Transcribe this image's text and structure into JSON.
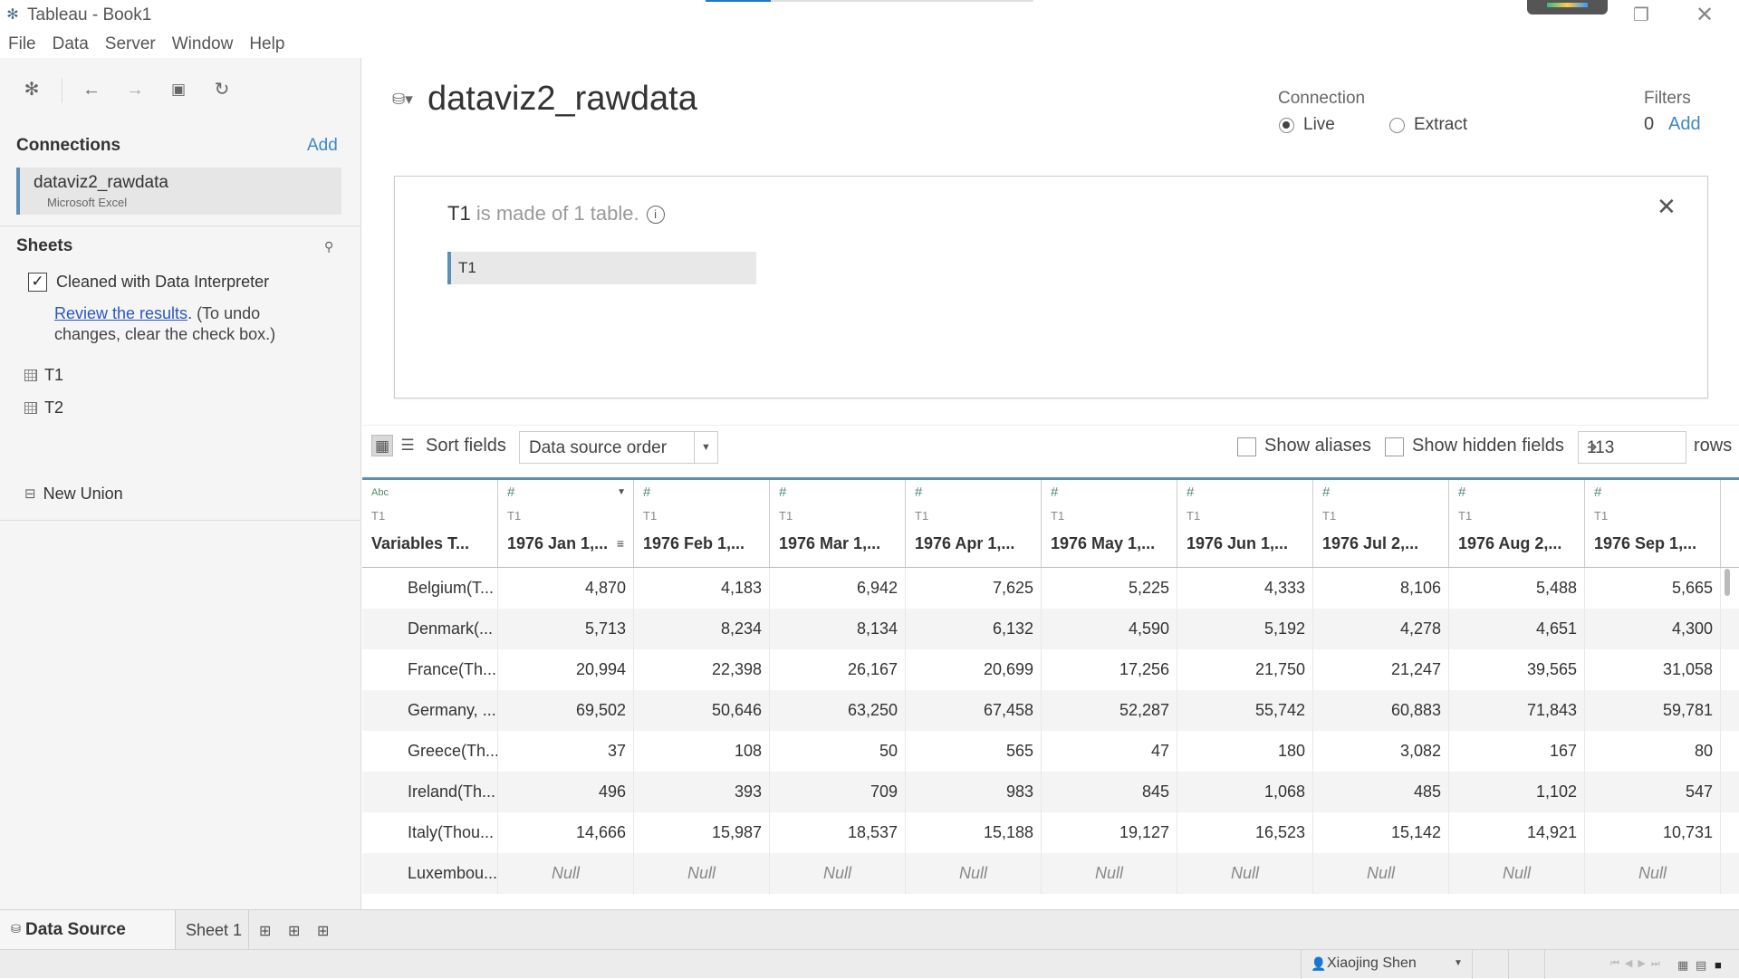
{
  "window": {
    "title": "Tableau - Book1",
    "progress": 0.2
  },
  "menu": [
    "File",
    "Data",
    "Server",
    "Window",
    "Help"
  ],
  "connections": {
    "heading": "Connections",
    "add_label": "Add",
    "items": [
      {
        "name": "dataviz2_rawdata",
        "type": "Microsoft Excel"
      }
    ]
  },
  "sheets": {
    "heading": "Sheets",
    "interpreter_label": "Cleaned with Data Interpreter",
    "interpreter_checked": true,
    "review_link": "Review the results",
    "review_note": ". (To undo changes, clear the check box.)",
    "items": [
      "T1",
      "T2"
    ],
    "new_union": "New Union"
  },
  "datasource": {
    "title": "dataviz2_rawdata",
    "connection_label": "Connection",
    "connection_options": [
      "Live",
      "Extract"
    ],
    "connection_selected": "Live",
    "filters_label": "Filters",
    "filters_count": "0",
    "filters_add": "Add"
  },
  "canvas": {
    "logical_table": "T1",
    "made_of_text": "is made of 1 table.",
    "table_chip": "T1"
  },
  "grid_toolbar": {
    "sort_label": "Sort fields",
    "sort_value": "Data source order",
    "show_aliases": "Show aliases",
    "show_hidden": "Show hidden fields",
    "rows_value": "113",
    "rows_label": "rows"
  },
  "grid": {
    "columns": [
      {
        "type": "Abc",
        "source": "T1",
        "name": "Variables T..."
      },
      {
        "type": "#",
        "source": "T1",
        "name": "1976 Jan 1,..."
      },
      {
        "type": "#",
        "source": "T1",
        "name": "1976 Feb 1,..."
      },
      {
        "type": "#",
        "source": "T1",
        "name": "1976 Mar 1,..."
      },
      {
        "type": "#",
        "source": "T1",
        "name": "1976 Apr 1,..."
      },
      {
        "type": "#",
        "source": "T1",
        "name": "1976 May 1,..."
      },
      {
        "type": "#",
        "source": "T1",
        "name": "1976 Jun 1,..."
      },
      {
        "type": "#",
        "source": "T1",
        "name": "1976 Jul 2,..."
      },
      {
        "type": "#",
        "source": "T1",
        "name": "1976 Aug 2,..."
      },
      {
        "type": "#",
        "source": "T1",
        "name": "1976 Sep 1,..."
      }
    ],
    "rows": [
      [
        "Belgium(T...",
        "4,870",
        "4,183",
        "6,942",
        "7,625",
        "5,225",
        "4,333",
        "8,106",
        "5,488",
        "5,665"
      ],
      [
        "Denmark(...",
        "5,713",
        "8,234",
        "8,134",
        "6,132",
        "4,590",
        "5,192",
        "4,278",
        "4,651",
        "4,300"
      ],
      [
        "France(Th...",
        "20,994",
        "22,398",
        "26,167",
        "20,699",
        "17,256",
        "21,750",
        "21,247",
        "39,565",
        "31,058"
      ],
      [
        "Germany, ...",
        "69,502",
        "50,646",
        "63,250",
        "67,458",
        "52,287",
        "55,742",
        "60,883",
        "71,843",
        "59,781"
      ],
      [
        "Greece(Th...",
        "37",
        "108",
        "50",
        "565",
        "47",
        "180",
        "3,082",
        "167",
        "80"
      ],
      [
        "Ireland(Th...",
        "496",
        "393",
        "709",
        "983",
        "845",
        "1,068",
        "485",
        "1,102",
        "547"
      ],
      [
        "Italy(Thou...",
        "14,666",
        "15,987",
        "18,537",
        "15,188",
        "19,127",
        "16,523",
        "15,142",
        "14,921",
        "10,731"
      ],
      [
        "Luxembou...",
        "Null",
        "Null",
        "Null",
        "Null",
        "Null",
        "Null",
        "Null",
        "Null",
        "Null"
      ]
    ]
  },
  "tabs": {
    "data_source": "Data Source",
    "sheet": "Sheet 1"
  },
  "status": {
    "user": "Xiaojing Shen"
  }
}
